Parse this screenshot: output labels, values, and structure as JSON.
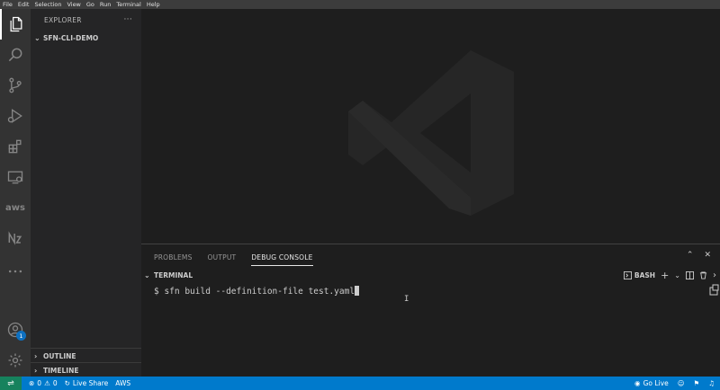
{
  "menu": [
    "File",
    "Edit",
    "Selection",
    "View",
    "Go",
    "Run",
    "Terminal",
    "Help"
  ],
  "sidebar": {
    "title": "EXPLORER",
    "more": "···",
    "folder": "SFN-CLI-DEMO",
    "outline": "OUTLINE",
    "timeline": "TIMELINE"
  },
  "activity": {
    "aws_label": "aws",
    "badge": "1"
  },
  "panel": {
    "tabs": [
      "PROBLEMS",
      "OUTPUT",
      "DEBUG CONSOLE"
    ],
    "active_tab": "DEBUG CONSOLE",
    "terminal_title": "TERMINAL",
    "shell": "BASH",
    "command": "$ sfn build --definition-file test.yaml"
  },
  "status": {
    "errors": "0",
    "warnings": "0",
    "live_share": "Live Share",
    "aws": "AWS",
    "go_live": "Go Live"
  },
  "colors": {
    "status_bar": "#007acc",
    "remote": "#16825d",
    "activity_bar": "#333333",
    "sidebar": "#252526",
    "editor": "#1e1e1e"
  }
}
